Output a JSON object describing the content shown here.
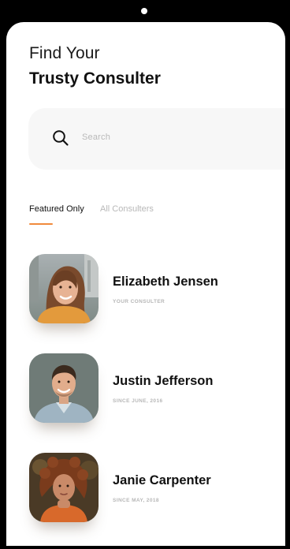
{
  "header": {
    "title_line1": "Find Your",
    "title_line2": "Trusty Consulter"
  },
  "search": {
    "placeholder": "Search",
    "icon": "search-icon"
  },
  "tabs": [
    {
      "label": "Featured Only",
      "active": true
    },
    {
      "label": "All Consulters",
      "active": false
    }
  ],
  "colors": {
    "accent": "#f08a3c",
    "muted_text": "#b8b8b8",
    "search_bg": "#f7f7f7"
  },
  "consultants": [
    {
      "name": "Elizabeth Jensen",
      "subtitle": "YOUR CONSULTER",
      "avatar": "avatar-photo"
    },
    {
      "name": "Justin Jefferson",
      "subtitle": "SINCE JUNE, 2016",
      "avatar": "avatar-photo"
    },
    {
      "name": "Janie Carpenter",
      "subtitle": "SINCE MAY, 2018",
      "avatar": "avatar-photo"
    }
  ]
}
